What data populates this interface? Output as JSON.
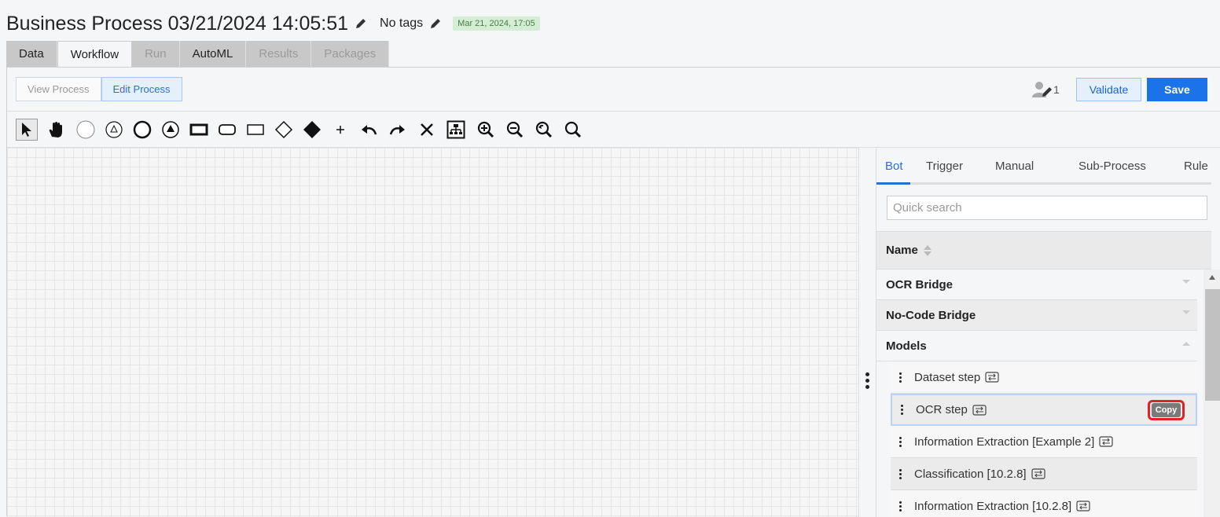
{
  "header": {
    "title": "Business Process 03/21/2024 14:05:51",
    "tags": "No tags",
    "date_badge": "Mar 21, 2024, 17:05"
  },
  "main_tabs": [
    {
      "label": "Data",
      "state": "enabled"
    },
    {
      "label": "Workflow",
      "state": "active"
    },
    {
      "label": "Run",
      "state": "disabled"
    },
    {
      "label": "AutoML",
      "state": "enabled"
    },
    {
      "label": "Results",
      "state": "disabled"
    },
    {
      "label": "Packages",
      "state": "disabled"
    }
  ],
  "topbar": {
    "view_process": "View Process",
    "edit_process": "Edit Process",
    "collaborators_count": "1",
    "validate": "Validate",
    "save": "Save"
  },
  "toolbar": [
    "pointer-icon",
    "hand-icon",
    "start-event-icon",
    "intermediate-event-icon",
    "end-event-icon",
    "signal-event-icon",
    "task-icon",
    "rounded-task-icon",
    "subprocess-icon",
    "gateway-icon",
    "exclusive-gateway-icon",
    "add-icon",
    "undo-icon",
    "redo-icon",
    "delete-icon",
    "auto-layout-icon",
    "zoom-in-icon",
    "zoom-out-icon",
    "zoom-reset-icon",
    "zoom-fit-icon"
  ],
  "side_panel": {
    "tabs": [
      "Bot",
      "Trigger",
      "Manual",
      "Sub-Process",
      "Rule"
    ],
    "active_tab": "Bot",
    "search_placeholder": "Quick search",
    "column_name": "Name",
    "groups": [
      {
        "label": "OCR Bridge",
        "expanded": false
      },
      {
        "label": "No-Code Bridge",
        "expanded": false
      },
      {
        "label": "Models",
        "expanded": true
      }
    ],
    "items": [
      {
        "label": "Dataset step"
      },
      {
        "label": "OCR step",
        "selected": true
      },
      {
        "label": "Information Extraction [Example 2]"
      },
      {
        "label": "Classification [10.2.8]"
      },
      {
        "label": "Information Extraction [10.2.8]"
      }
    ],
    "copy_label": "Copy"
  },
  "colors": {
    "accent": "#1a73e8",
    "date_badge_bg": "#d4edd4",
    "copy_highlight": "#e0202a"
  }
}
